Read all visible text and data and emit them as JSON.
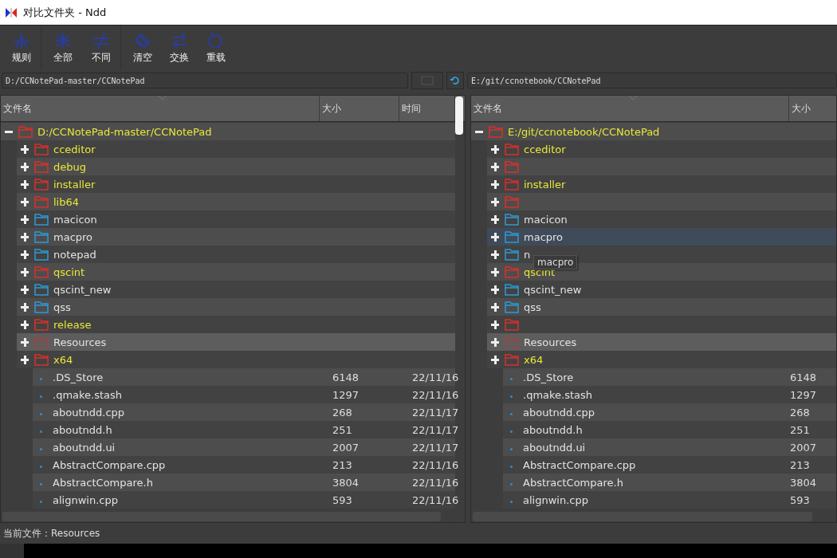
{
  "window": {
    "title": "对比文件夹 - Ndd"
  },
  "toolbar": [
    {
      "label": "规则",
      "group_end": true
    },
    {
      "label": "全部",
      "group_end": false
    },
    {
      "label": "不同",
      "group_end": true
    },
    {
      "label": "清空",
      "group_end": false
    },
    {
      "label": "交换",
      "group_end": false
    },
    {
      "label": "重载",
      "group_end": false
    }
  ],
  "panels": [
    {
      "path": "D:/CCNotePad-master/CCNotePad",
      "columns": [
        "文件名",
        "大小",
        "时间"
      ],
      "scrollbar": true,
      "tree": {
        "kind": "folder",
        "name": "D:/CCNotePad-master/CCNotePad",
        "differs": true,
        "expanded": true,
        "selected": false,
        "hovered": false,
        "children": [
          {
            "kind": "folder",
            "name": "cceditor",
            "differs": true,
            "expanded": false,
            "selected": false,
            "hovered": false
          },
          {
            "kind": "folder",
            "name": "debug",
            "differs": true,
            "expanded": false,
            "selected": false,
            "hovered": false
          },
          {
            "kind": "folder",
            "name": "installer",
            "differs": true,
            "expanded": false,
            "selected": false,
            "hovered": false
          },
          {
            "kind": "folder",
            "name": "lib64",
            "differs": true,
            "expanded": false,
            "selected": false,
            "hovered": false
          },
          {
            "kind": "folder",
            "name": "macicon",
            "differs": false,
            "expanded": false,
            "selected": false,
            "hovered": false
          },
          {
            "kind": "folder",
            "name": "macpro",
            "differs": false,
            "expanded": false,
            "selected": false,
            "hovered": false
          },
          {
            "kind": "folder",
            "name": "notepad",
            "differs": false,
            "expanded": false,
            "selected": false,
            "hovered": false
          },
          {
            "kind": "folder",
            "name": "qscint",
            "differs": true,
            "expanded": false,
            "selected": false,
            "hovered": false
          },
          {
            "kind": "folder",
            "name": "qscint_new",
            "differs": false,
            "expanded": false,
            "selected": false,
            "hovered": false
          },
          {
            "kind": "folder",
            "name": "qss",
            "differs": false,
            "expanded": false,
            "selected": false,
            "hovered": false
          },
          {
            "kind": "folder",
            "name": "release",
            "differs": true,
            "expanded": false,
            "selected": false,
            "hovered": false
          },
          {
            "kind": "folder",
            "name": "Resources",
            "differs": true,
            "expanded": false,
            "selected": true,
            "hovered": false
          },
          {
            "kind": "folder",
            "name": "x64",
            "differs": true,
            "expanded": false,
            "selected": false,
            "hovered": false
          },
          {
            "kind": "file",
            "name": ".DS_Store",
            "size": "6148",
            "time": "22/11/16",
            "selected": false,
            "hovered": false
          },
          {
            "kind": "file",
            "name": ".qmake.stash",
            "size": "1297",
            "time": "22/11/16",
            "selected": false,
            "hovered": false
          },
          {
            "kind": "file",
            "name": "aboutndd.cpp",
            "size": "268",
            "time": "22/11/17",
            "selected": false,
            "hovered": false
          },
          {
            "kind": "file",
            "name": "aboutndd.h",
            "size": "251",
            "time": "22/11/17",
            "selected": false,
            "hovered": false
          },
          {
            "kind": "file",
            "name": "aboutndd.ui",
            "size": "2007",
            "time": "22/11/17",
            "selected": false,
            "hovered": false
          },
          {
            "kind": "file",
            "name": "AbstractCompare.cpp",
            "size": "213",
            "time": "22/11/16",
            "selected": false,
            "hovered": false
          },
          {
            "kind": "file",
            "name": "AbstractCompare.h",
            "size": "3804",
            "time": "22/11/16",
            "selected": false,
            "hovered": false
          },
          {
            "kind": "file",
            "name": "alignwin.cpp",
            "size": "593",
            "time": "22/11/16",
            "selected": false,
            "hovered": false
          }
        ]
      }
    },
    {
      "path": "E:/git/ccnotebook/CCNotePad",
      "columns": [
        "文件名",
        "大小"
      ],
      "scrollbar": false,
      "tooltip": "macpro",
      "tree": {
        "kind": "folder",
        "name": "E:/git/ccnotebook/CCNotePad",
        "differs": true,
        "expanded": true,
        "selected": false,
        "hovered": false,
        "children": [
          {
            "kind": "folder",
            "name": "cceditor",
            "differs": true,
            "expanded": false,
            "selected": false,
            "hovered": false
          },
          {
            "kind": "folder",
            "differs": true,
            "expanded": false,
            "selected": false,
            "hovered": false
          },
          {
            "kind": "folder",
            "name": "installer",
            "differs": true,
            "expanded": false,
            "selected": false,
            "hovered": false
          },
          {
            "kind": "folder",
            "differs": true,
            "expanded": false,
            "selected": false,
            "hovered": false
          },
          {
            "kind": "folder",
            "name": "macicon",
            "differs": false,
            "expanded": false,
            "selected": false,
            "hovered": false
          },
          {
            "kind": "folder",
            "name": "macpro",
            "differs": false,
            "expanded": false,
            "selected": false,
            "hovered": true
          },
          {
            "kind": "folder",
            "name": "n",
            "differs": false,
            "expanded": false,
            "selected": false,
            "hovered": false
          },
          {
            "kind": "folder",
            "name": "qscint",
            "differs": true,
            "expanded": false,
            "selected": false,
            "hovered": false
          },
          {
            "kind": "folder",
            "name": "qscint_new",
            "differs": false,
            "expanded": false,
            "selected": false,
            "hovered": false
          },
          {
            "kind": "folder",
            "name": "qss",
            "differs": false,
            "expanded": false,
            "selected": false,
            "hovered": false
          },
          {
            "kind": "folder",
            "differs": true,
            "expanded": false,
            "selected": false,
            "hovered": false
          },
          {
            "kind": "folder",
            "name": "Resources",
            "differs": true,
            "expanded": false,
            "selected": true,
            "hovered": false
          },
          {
            "kind": "folder",
            "name": "x64",
            "differs": true,
            "expanded": false,
            "selected": false,
            "hovered": false
          },
          {
            "kind": "file",
            "name": ".DS_Store",
            "size": "6148",
            "selected": false,
            "hovered": false
          },
          {
            "kind": "file",
            "name": ".qmake.stash",
            "size": "1297",
            "selected": false,
            "hovered": false
          },
          {
            "kind": "file",
            "name": "aboutndd.cpp",
            "size": "268",
            "selected": false,
            "hovered": false
          },
          {
            "kind": "file",
            "name": "aboutndd.h",
            "size": "251",
            "selected": false,
            "hovered": false
          },
          {
            "kind": "file",
            "name": "aboutndd.ui",
            "size": "2007",
            "selected": false,
            "hovered": false
          },
          {
            "kind": "file",
            "name": "AbstractCompare.cpp",
            "size": "213",
            "selected": false,
            "hovered": false
          },
          {
            "kind": "file",
            "name": "AbstractCompare.h",
            "size": "3804",
            "selected": false,
            "hovered": false
          },
          {
            "kind": "file",
            "name": "alignwin.cpp",
            "size": "593",
            "selected": false,
            "hovered": false
          }
        ]
      }
    }
  ],
  "status_bar": "当前文件：Resources"
}
